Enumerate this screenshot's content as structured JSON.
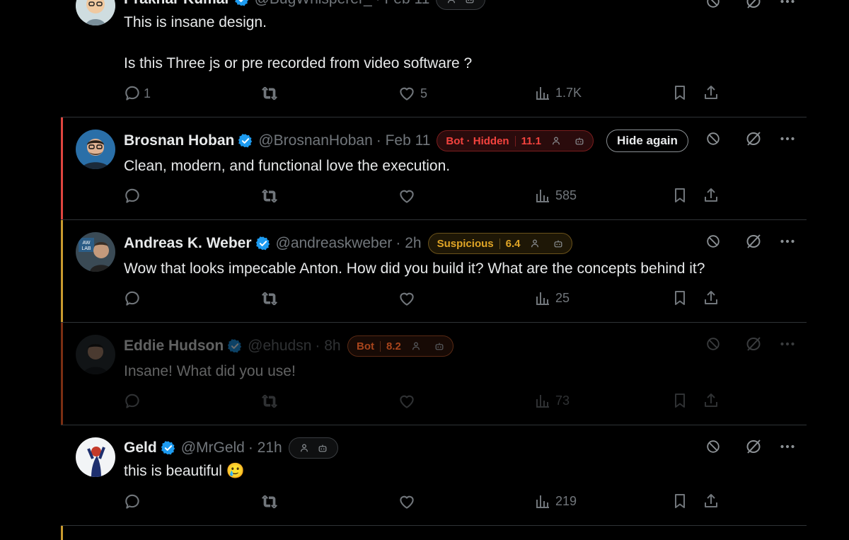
{
  "tweets": [
    {
      "name": "Prakhar Kumar",
      "handle": "@BugWhisperer_",
      "time": "· Feb 11",
      "text": "This is insane design.\n\nIs this Three js or pre recorded from video software ?",
      "replies": "1",
      "reposts": "",
      "likes": "5",
      "views": "1.7K"
    },
    {
      "name": "Brosnan Hoban",
      "handle": "@BrosnanHoban",
      "time": "· Feb 11",
      "badge_label": "Bot · Hidden",
      "badge_score": "11.1",
      "badge_color": "#f4433e",
      "bar_color": "#e0453f",
      "hide_again": "Hide again",
      "text": "Clean, modern, and functional love the execution.",
      "replies": "",
      "reposts": "",
      "likes": "",
      "views": "585"
    },
    {
      "name": "Andreas K. Weber",
      "handle": "@andreaskweber",
      "time": "· 2h",
      "badge_label": "Suspicious",
      "badge_score": "6.4",
      "badge_color": "#e0a526",
      "bar_color": "#c99a2e",
      "text": "Wow that looks impecable Anton. How did you build it? What are the concepts behind it?",
      "replies": "",
      "reposts": "",
      "likes": "",
      "views": "25"
    },
    {
      "name": "Eddie Hudson",
      "handle": "@ehudsn",
      "time": "· 8h",
      "badge_label": "Bot",
      "badge_score": "8.2",
      "badge_color": "#a8451c",
      "bar_color": "#7a2e12",
      "text": "Insane! What did you use!",
      "replies": "",
      "reposts": "",
      "likes": "",
      "views": "73"
    },
    {
      "name": "Geld",
      "handle": "@MrGeld",
      "time": "· 21h",
      "text": "this is beautiful 🥲",
      "replies": "",
      "reposts": "",
      "likes": "",
      "views": "219"
    }
  ],
  "icons": [
    "reply-icon",
    "repost-icon",
    "like-icon",
    "views-icon",
    "bookmark-icon",
    "share-icon",
    "block-icon",
    "mute-icon",
    "more-icon",
    "verified-icon",
    "person-icon",
    "robot-icon"
  ],
  "colors": {
    "accent": "#1d9bf0",
    "muted": "#71767b",
    "text": "#e7e9ea"
  }
}
